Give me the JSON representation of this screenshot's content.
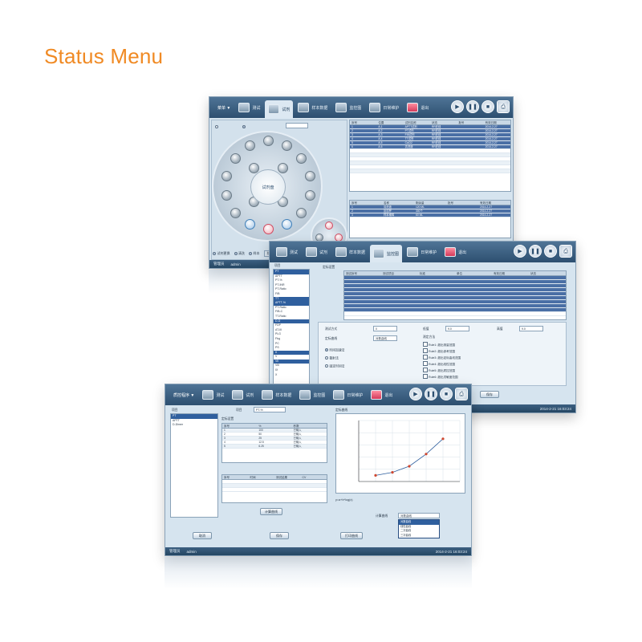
{
  "page": {
    "title": "Status Menu",
    "title_color": "#f08a24"
  },
  "window_main": {
    "toolbar_items": [
      "测试",
      "试剂",
      "样本数据",
      "监控图",
      "日常维护",
      "退出"
    ],
    "menu_label": "菜单 ▼",
    "statusbar": {
      "user_label": "管理员",
      "user": "admin"
    },
    "top_table": {
      "headers": [
        "序号",
        "位置",
        "试剂名称",
        "状态",
        "批号",
        "有效日期"
      ],
      "rows": [
        [
          "1",
          "A-1",
          "APTT试剂",
          "RR在线",
          "",
          "2014-2-27"
        ],
        [
          "2",
          "A-2",
          "PT试剂",
          "RR在线",
          "",
          "2014-2-27"
        ],
        [
          "3",
          "A-3",
          "FIB试剂",
          "RR在线",
          "",
          "2014-2-27"
        ],
        [
          "4",
          "A-4",
          "TT试剂",
          "RR在线",
          "",
          "2014-2-27"
        ],
        [
          "5",
          "A-5",
          "CaCl2",
          "RR在线",
          "",
          "2014-2-27"
        ],
        [
          "6",
          "A-6",
          "清洗液",
          "RR在线",
          "",
          "2014-2-27"
        ]
      ]
    },
    "bottom_table": {
      "headers": [
        "序号",
        "名称",
        "剩余量",
        "批号",
        "有效日期"
      ],
      "rows": [
        [
          "1",
          "清洗液",
          "120 ML",
          "",
          "2014-2-27"
        ],
        [
          "2",
          "反应杯",
          "300个",
          "",
          "2014-2-27"
        ],
        [
          "3",
          "样本稀释",
          "60 ML",
          "",
          "2014-2-27"
        ]
      ]
    },
    "carousel_center": "试剂盘",
    "bottom_buttons": [
      "试剂更换",
      "清洗",
      "样本",
      "状态设置 ▼"
    ]
  },
  "window_mid": {
    "toolbar_items": [
      "测试",
      "试剂",
      "样本数据",
      "监控图",
      "日常维护",
      "退出"
    ],
    "list_title": "项目",
    "list_items": [
      "PT",
      "APTT",
      "PT-%",
      "PT-INR",
      "PT-Ratio",
      "FIB",
      "TT",
      "APTT-%",
      "PT-Ratio",
      "FIB-C",
      "TT-Ratio",
      "D-D",
      "FDP",
      "AT-III",
      "PLG",
      "Fbg",
      "PC",
      "PS",
      "II",
      "V",
      "VII",
      "VIII",
      "IX",
      "X"
    ],
    "selected_index": 0,
    "table_headers": [
      "测试序号",
      "测试项目",
      "标准",
      "单位",
      "有效日期",
      "状态"
    ],
    "row_count": 11,
    "labels": {
      "calibration": "定标设置",
      "mode": "测试方式",
      "curve": "定标曲线",
      "low": "低值",
      "high": "高值",
      "method": "测定方法"
    },
    "fields": {
      "low_value": "9.0",
      "high_value": "9.0",
      "mode_value": "0",
      "curve_value": "对数曲线"
    },
    "radios": [
      "时间加速法",
      "散射法",
      "固定时间法"
    ],
    "checks": [
      "Rule1: 超出测量范围",
      "Rule2: 超出参考范围",
      "Rule3: 超出定标曲线范围",
      "Rule4: 超出线性范围",
      "Rule5: 超出质控范围",
      "Rule6: 超出灵敏度范围"
    ],
    "save_button": "保存",
    "statusbar": {
      "datetime": "2014-2-21 16:03:24"
    }
  },
  "window_front": {
    "toolbar_items": [
      "测试",
      "试剂",
      "样本数据",
      "监控图",
      "日常维护",
      "退出"
    ],
    "menu_label": "质控程序 ▼",
    "list_title": "项目",
    "list_items": [
      "PT",
      "APTT",
      "D-Dimer"
    ],
    "selected_index": 0,
    "project_label": "项目",
    "project_value": "PT-%",
    "std_title": "定标设置",
    "std_headers": [
      "序号",
      "%",
      "秒数"
    ],
    "std_rows": [
      [
        "1",
        "100",
        "已输入"
      ],
      [
        "2",
        "50",
        "已输入"
      ],
      [
        "3",
        "25",
        "已输入"
      ],
      [
        "4",
        "12.5",
        "已输入"
      ],
      [
        "5",
        "6.25",
        "已输入"
      ]
    ],
    "result_headers": [
      "序号",
      "时间",
      "测试结果",
      "CV"
    ],
    "calc_button": "计算曲线",
    "chart_title": "定标曲线",
    "chart_note": "y=a+b*log(x)",
    "dropdown_label": "计算曲线",
    "dropdown_value": "对数曲线",
    "dropdown_options": [
      "对数曲线",
      "线性曲线",
      "二次曲线",
      "三次曲线"
    ],
    "dropdown_selected": 0,
    "buttons": [
      "取消",
      "保存",
      "打印曲线"
    ],
    "statusbar": {
      "user_label": "管理员",
      "user": "admin",
      "datetime": "2014-2-21 16:03:24"
    }
  },
  "chart_data": {
    "type": "line",
    "x": [
      1,
      2,
      3,
      4,
      5
    ],
    "y": [
      10,
      15,
      25,
      45,
      70
    ],
    "xlim": [
      0,
      6
    ],
    "ylim": [
      0,
      100
    ],
    "grid": true
  }
}
